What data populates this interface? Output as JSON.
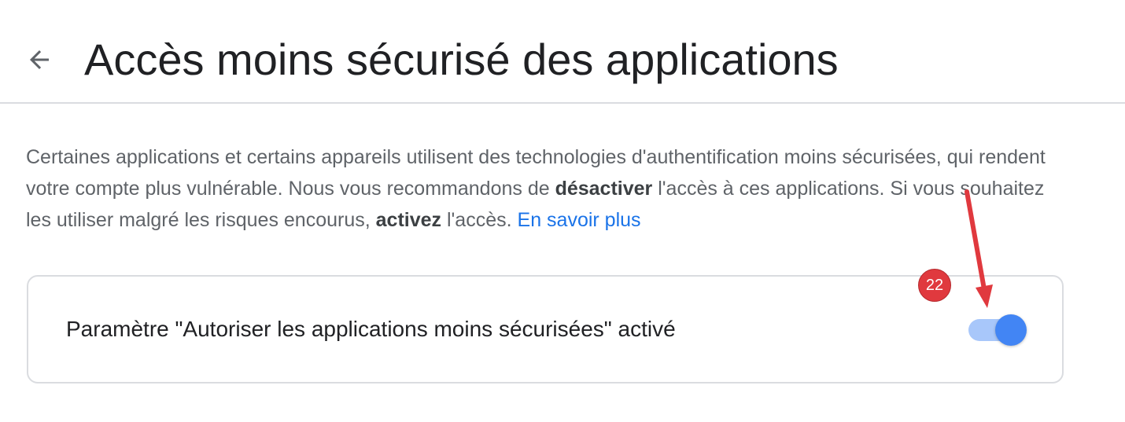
{
  "header": {
    "title": "Accès moins sécurisé des applications",
    "back_icon": "arrow-back-icon"
  },
  "description": {
    "part1": "Certaines applications et certains appareils utilisent des technologies d'authentification moins sécurisées, qui rendent votre compte plus vulnérable. Nous vous recommandons de ",
    "bold1": "désactiver",
    "part2": " l'accès à ces applications. Si vous souhaitez les utiliser malgré les risques encourus, ",
    "bold2": "activez",
    "part3": " l'accès. ",
    "link": "En savoir plus"
  },
  "setting": {
    "label": "Paramètre \"Autoriser les applications moins sécurisées\" activé",
    "toggle_on": true
  },
  "annotation": {
    "badge": "22"
  },
  "colors": {
    "accent": "#4285f4",
    "track": "#a8c7fa",
    "link": "#1a73e8",
    "annotation": "#e0393e"
  }
}
